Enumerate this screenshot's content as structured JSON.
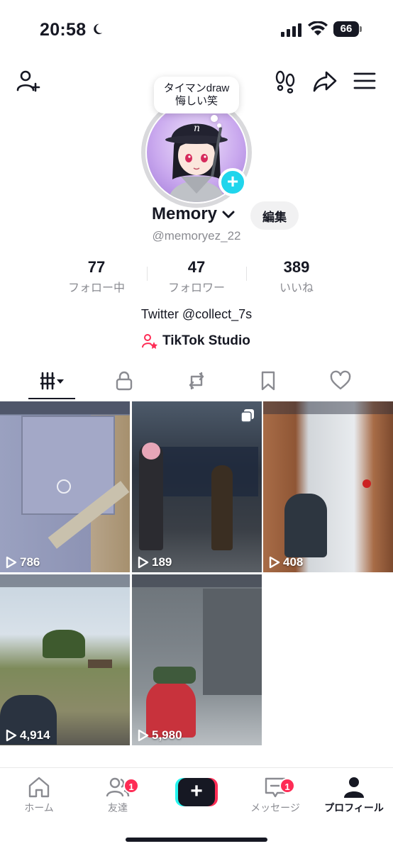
{
  "status_bar": {
    "time": "20:58",
    "battery": "66"
  },
  "header": {
    "add_friend_icon": "person-plus-icon",
    "footprint_icon": "footprints-icon",
    "share_icon": "share-arrow-icon",
    "menu_icon": "hamburger-menu-icon"
  },
  "profile": {
    "note_line1": "タイマンdraw",
    "note_line2": "悔しい笑",
    "username": "Memory",
    "edit_label": "編集",
    "handle": "@memoryez_22",
    "stats": [
      {
        "value": "77",
        "label": "フォロー中"
      },
      {
        "value": "47",
        "label": "フォロワー"
      },
      {
        "value": "389",
        "label": "いいね"
      }
    ],
    "bio": "Twitter @collect_7s",
    "studio_label": "TikTok Studio"
  },
  "tabs": [
    {
      "name": "videos",
      "icon": "grid-bars-icon"
    },
    {
      "name": "private",
      "icon": "lock-icon"
    },
    {
      "name": "reposts",
      "icon": "repost-icon"
    },
    {
      "name": "favorites",
      "icon": "bookmark-icon"
    },
    {
      "name": "liked",
      "icon": "heart-icon"
    }
  ],
  "videos": [
    {
      "views": "786"
    },
    {
      "views": "189"
    },
    {
      "views": "408"
    },
    {
      "views": "4,914"
    },
    {
      "views": "5,980"
    }
  ],
  "bottom_nav": {
    "home": "ホーム",
    "friends": "友達",
    "friends_badge": "1",
    "inbox": "メッセージ",
    "inbox_badge": "1",
    "profile": "プロフィール",
    "create_label": "+"
  },
  "colors": {
    "accent_pink": "#fe2c55",
    "accent_cyan": "#25f4ee",
    "plus_badge": "#20d5ec",
    "text_primary": "#161823",
    "text_secondary": "#8a8b91"
  }
}
